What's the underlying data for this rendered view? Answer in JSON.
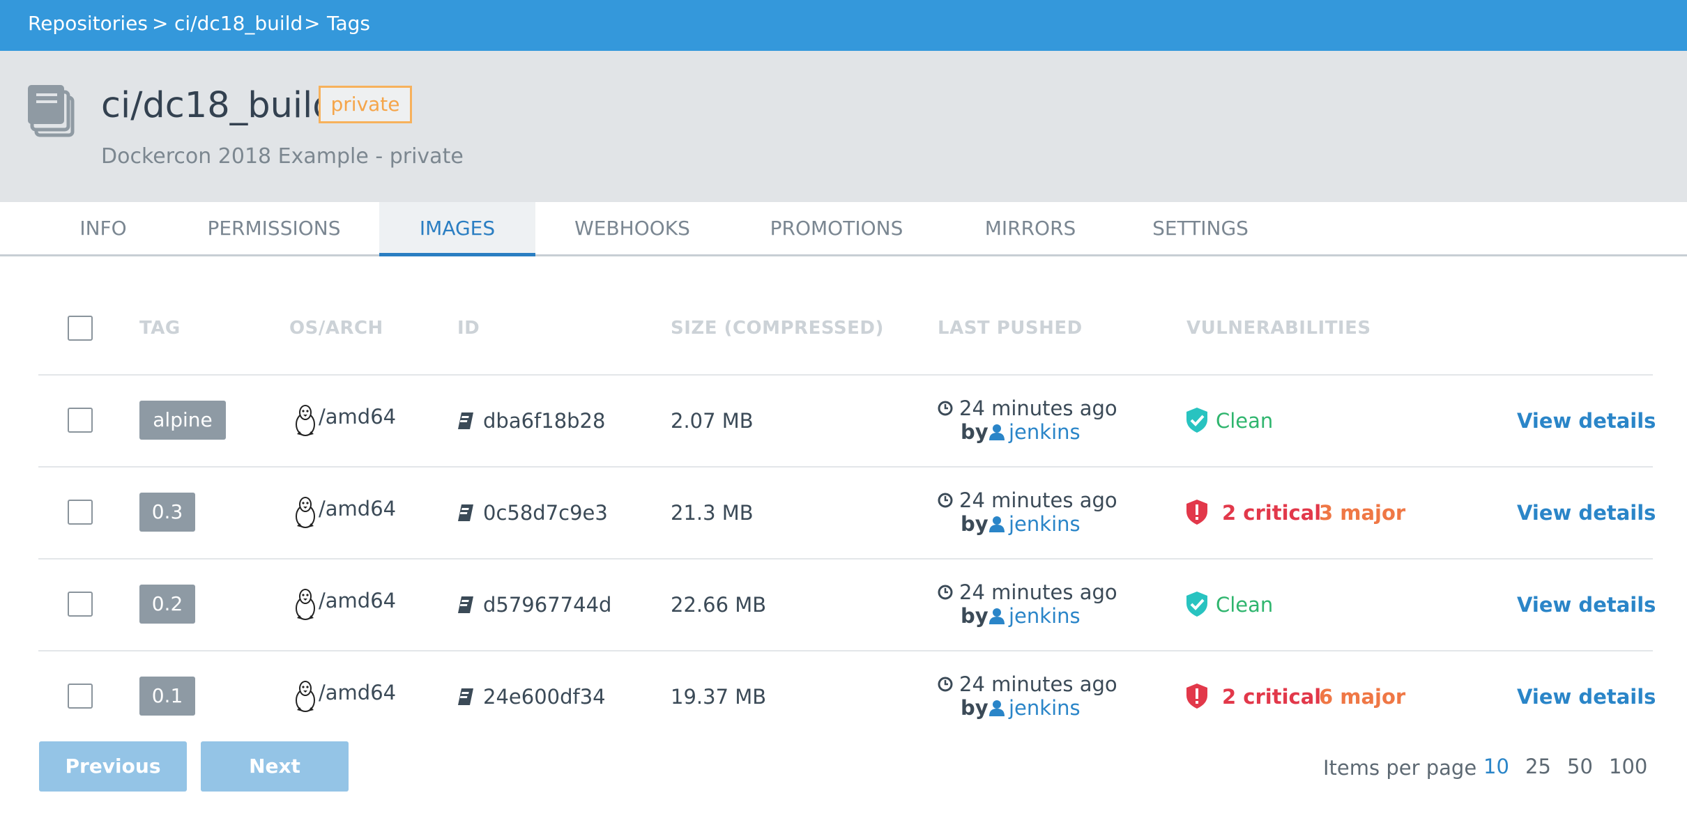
{
  "breadcrumb": {
    "items": [
      "Repositories",
      "ci/dc18_build",
      "Tags"
    ],
    "separator": ">"
  },
  "repo": {
    "icon": "repository-books-icon",
    "name": "ci/dc18_build",
    "visibility": "private",
    "description": "Dockercon 2018 Example - private"
  },
  "tabs": [
    {
      "label": "INFO",
      "active": false
    },
    {
      "label": "PERMISSIONS",
      "active": false
    },
    {
      "label": "IMAGES",
      "active": true
    },
    {
      "label": "WEBHOOKS",
      "active": false
    },
    {
      "label": "PROMOTIONS",
      "active": false
    },
    {
      "label": "MIRRORS",
      "active": false
    },
    {
      "label": "SETTINGS",
      "active": false
    }
  ],
  "table": {
    "headers": {
      "tag": "TAG",
      "os_arch": "OS/ARCH",
      "id": "ID",
      "size": "SIZE (COMPRESSED)",
      "last_pushed": "LAST PUSHED",
      "vulnerabilities": "VULNERABILITIES"
    },
    "rows": [
      {
        "tag": "alpine",
        "arch": "/amd64",
        "id": "dba6f18b28",
        "size": "2.07 MB",
        "pushed": "24 minutes ago",
        "by": "by",
        "user": "jenkins",
        "vuln_status": "clean",
        "clean_label": "Clean",
        "critical": "",
        "major": "",
        "link": "View details"
      },
      {
        "tag": "0.3",
        "arch": "/amd64",
        "id": "0c58d7c9e3",
        "size": "21.3 MB",
        "pushed": "24 minutes ago",
        "by": "by",
        "user": "jenkins",
        "vuln_status": "vulnerable",
        "clean_label": "",
        "critical": "2 critical",
        "major": "3 major",
        "link": "View details"
      },
      {
        "tag": "0.2",
        "arch": "/amd64",
        "id": "d57967744d",
        "size": "22.66 MB",
        "pushed": "24 minutes ago",
        "by": "by",
        "user": "jenkins",
        "vuln_status": "clean",
        "clean_label": "Clean",
        "critical": "",
        "major": "",
        "link": "View details"
      },
      {
        "tag": "0.1",
        "arch": "/amd64",
        "id": "24e600df34",
        "size": "19.37 MB",
        "pushed": "24 minutes ago",
        "by": "by",
        "user": "jenkins",
        "vuln_status": "vulnerable",
        "clean_label": "",
        "critical": "2 critical",
        "major": "6 major",
        "link": "View details"
      }
    ]
  },
  "pagination": {
    "previous": "Previous",
    "next": "Next",
    "items_per_page_label": "Items per page",
    "options": [
      "10",
      "25",
      "50",
      "100"
    ],
    "selected": "10"
  },
  "colors": {
    "topbar": "#3498db",
    "accent": "#2a7ec2",
    "clean": "#2fb56e",
    "critical": "#e2384a",
    "major": "#ef7745",
    "private_badge": "#f7b15c"
  }
}
